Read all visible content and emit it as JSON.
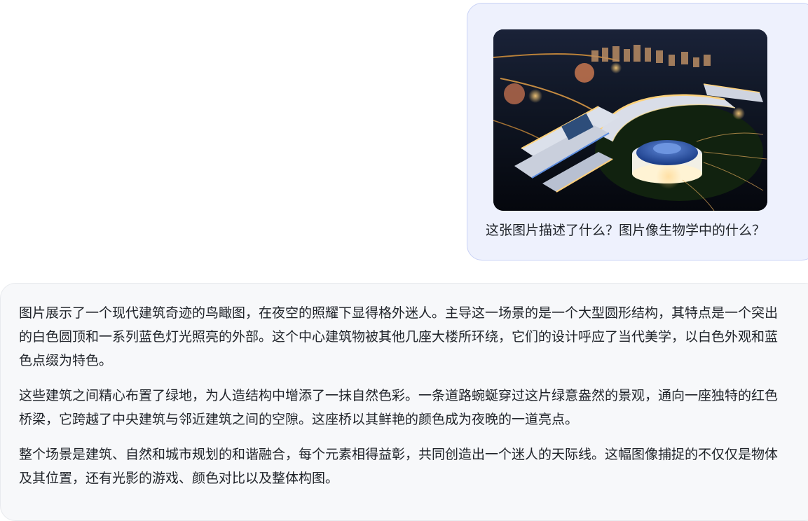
{
  "user_message": {
    "question": "这张图片描述了什么？图片像生物学中的什么？"
  },
  "assistant_message": {
    "paragraphs": [
      "图片展示了一个现代建筑奇迹的鸟瞰图，在夜空的照耀下显得格外迷人。主导这一场景的是一个大型圆形结构，其特点是一个突出的白色圆顶和一系列蓝色灯光照亮的外部。这个中心建筑物被其他几座大楼所环绕，它们的设计呼应了当代美学，以白色外观和蓝色点缀为特色。",
      "这些建筑之间精心布置了绿地，为人造结构中增添了一抹自然色彩。一条道路蜿蜒穿过这片绿意盎然的景观，通向一座独特的红色桥梁，它跨越了中央建筑与邻近建筑之间的空隙。这座桥以其鲜艳的颜色成为夜晚的一道亮点。",
      "整个场景是建筑、自然和城市规划的和谐融合，每个元素相得益彰，共同创造出一个迷人的天际线。这幅图像捕捉的不仅仅是物体及其位置，还有光影的游戏、颜色对比以及整体构图。"
    ]
  },
  "colors": {
    "user_bubble_bg": "#eef1fd",
    "user_bubble_border": "#c9d2f5",
    "assistant_bubble_bg": "#f7f8fa",
    "text": "#1f2329"
  }
}
